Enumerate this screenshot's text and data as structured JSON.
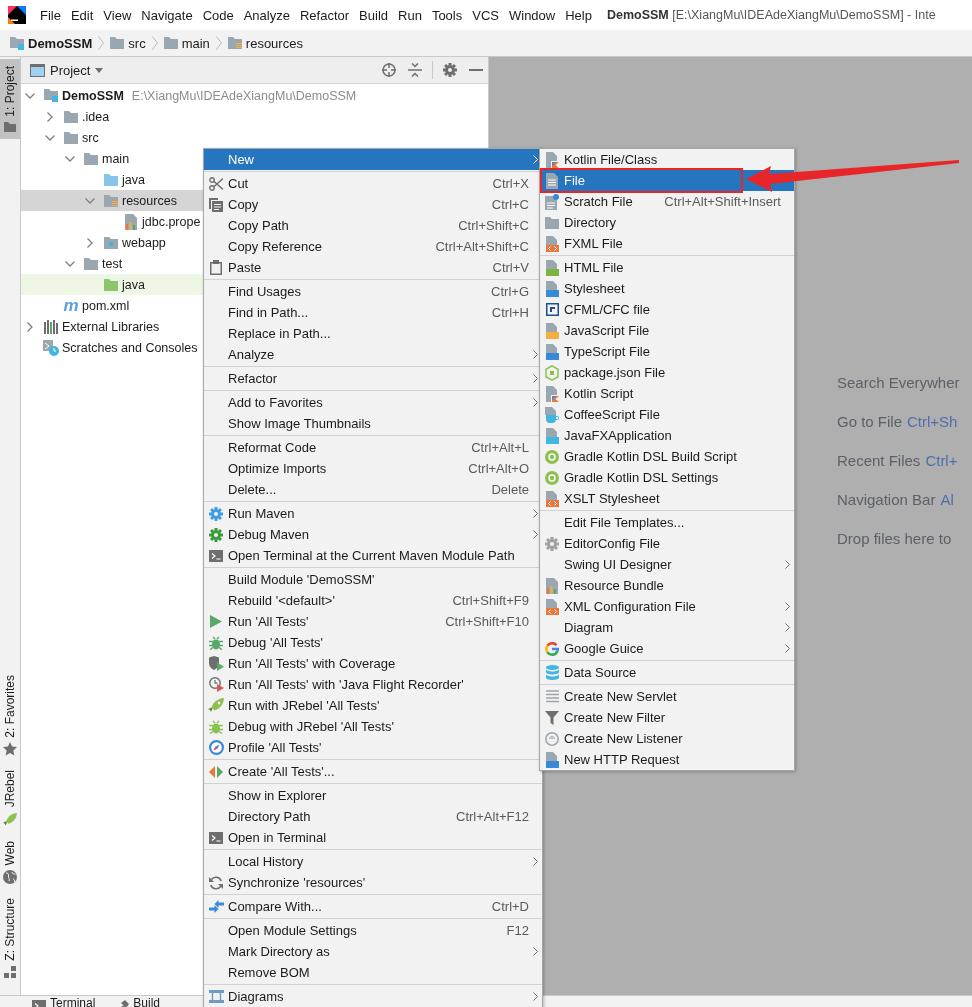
{
  "menubar": {
    "items": [
      {
        "label": "File"
      },
      {
        "label": "Edit"
      },
      {
        "label": "View"
      },
      {
        "label": "Navigate"
      },
      {
        "label": "Code"
      },
      {
        "label": "Analyze"
      },
      {
        "label": "Refactor"
      },
      {
        "label": "Build"
      },
      {
        "label": "Run"
      },
      {
        "label": "Tools"
      },
      {
        "label": "VCS"
      },
      {
        "label": "Window"
      },
      {
        "label": "Help"
      }
    ],
    "title": "**DemoSSM** [E:\\XiangMu\\IDEAdeXiangMu\\DemoSSM] - Inte"
  },
  "breadcrumb": [
    {
      "label": "DemoSSM",
      "kind": "module"
    },
    {
      "label": "src",
      "kind": "folder"
    },
    {
      "label": "main",
      "kind": "folder"
    },
    {
      "label": "resources",
      "kind": "resources"
    }
  ],
  "tool_strip": {
    "top": [
      {
        "label": "1: Project",
        "kind": "project",
        "selected": true
      }
    ],
    "bottom": [
      {
        "label": "2: Favorites",
        "kind": "favorites",
        "selected": false
      },
      {
        "label": "JRebel",
        "kind": "jrebel",
        "selected": false
      },
      {
        "label": "Web",
        "kind": "web",
        "selected": false
      },
      {
        "label": "Z: Structure",
        "kind": "structure",
        "selected": false
      }
    ]
  },
  "project_panel": {
    "title": "Project",
    "tree": [
      {
        "label": "DemoSSM",
        "path": "E:\\XiangMu\\IDEAdeXiangMu\\DemoSSM",
        "kind": "module",
        "expanded": true,
        "selected": false,
        "children": [
          {
            "label": ".idea",
            "kind": "folder",
            "expanded": false,
            "selected": false
          },
          {
            "label": "src",
            "kind": "folder",
            "expanded": true,
            "selected": false,
            "children": [
              {
                "label": "main",
                "kind": "folder",
                "expanded": true,
                "selected": false,
                "children": [
                  {
                    "label": "java",
                    "kind": "source",
                    "selected": false
                  },
                  {
                    "label": "resources",
                    "kind": "resources",
                    "expanded": true,
                    "selected": true,
                    "children": [
                      {
                        "label": "jdbc.prope",
                        "kind": "properties",
                        "selected": false
                      }
                    ]
                  },
                  {
                    "label": "webapp",
                    "kind": "web",
                    "expanded": false,
                    "selected": false
                  }
                ]
              },
              {
                "label": "test",
                "kind": "folder",
                "expanded": true,
                "selected": false,
                "children": [
                  {
                    "label": "java",
                    "kind": "test",
                    "color": "#eef7e6",
                    "selected": false
                  }
                ]
              }
            ]
          },
          {
            "label": "pom.xml",
            "kind": "maven",
            "glyph": "m",
            "selected": false
          }
        ]
      },
      {
        "label": "External Libraries",
        "kind": "libraries",
        "expanded": false,
        "selected": false
      },
      {
        "label": "Scratches and Consoles",
        "kind": "scratches",
        "selected": false
      }
    ]
  },
  "context_menu": {
    "groups": [
      [
        {
          "label": "New",
          "kind": "plain",
          "submenu": true,
          "selected": true
        }
      ],
      [
        {
          "label": "Cut",
          "shortcut": "Ctrl+X",
          "kind": "cut",
          "submenu": false,
          "selected": false
        },
        {
          "label": "Copy",
          "shortcut": "Ctrl+C",
          "kind": "copy",
          "submenu": false,
          "selected": false
        },
        {
          "label": "Copy Path",
          "shortcut": "Ctrl+Shift+C",
          "kind": "plain",
          "submenu": false,
          "selected": false
        },
        {
          "label": "Copy Reference",
          "shortcut": "Ctrl+Alt+Shift+C",
          "kind": "plain",
          "submenu": false,
          "selected": false
        },
        {
          "label": "Paste",
          "shortcut": "Ctrl+V",
          "kind": "paste",
          "submenu": false,
          "selected": false
        }
      ],
      [
        {
          "label": "Find Usages",
          "shortcut": "Ctrl+G",
          "kind": "plain",
          "submenu": false,
          "selected": false
        },
        {
          "label": "Find in Path...",
          "shortcut": "Ctrl+H",
          "kind": "plain",
          "submenu": false,
          "selected": false
        },
        {
          "label": "Replace in Path...",
          "kind": "plain",
          "submenu": false,
          "selected": false
        },
        {
          "label": "Analyze",
          "kind": "plain",
          "submenu": true,
          "selected": false
        }
      ],
      [
        {
          "label": "Refactor",
          "kind": "plain",
          "submenu": true,
          "selected": false
        }
      ],
      [
        {
          "label": "Add to Favorites",
          "kind": "plain",
          "submenu": true,
          "selected": false
        },
        {
          "label": "Show Image Thumbnails",
          "kind": "plain",
          "submenu": false,
          "selected": false
        }
      ],
      [
        {
          "label": "Reformat Code",
          "shortcut": "Ctrl+Alt+L",
          "kind": "plain",
          "submenu": false,
          "selected": false
        },
        {
          "label": "Optimize Imports",
          "shortcut": "Ctrl+Alt+O",
          "kind": "plain",
          "submenu": false,
          "selected": false
        },
        {
          "label": "Delete...",
          "shortcut": "Delete",
          "kind": "plain",
          "submenu": false,
          "selected": false
        }
      ],
      [
        {
          "label": "Run Maven",
          "kind": "mavenrun",
          "submenu": true,
          "selected": false
        },
        {
          "label": "Debug Maven",
          "kind": "mavendebug",
          "submenu": true,
          "selected": false
        },
        {
          "label": "Open Terminal at the Current Maven Module Path",
          "kind": "terminal",
          "submenu": false,
          "selected": false
        }
      ],
      [
        {
          "label": "Build Module 'DemoSSM'",
          "kind": "plain",
          "submenu": false,
          "selected": false
        },
        {
          "label": "Rebuild '<default>'",
          "shortcut": "Ctrl+Shift+F9",
          "kind": "plain",
          "submenu": false,
          "selected": false
        },
        {
          "label": "Run 'All Tests'",
          "shortcut": "Ctrl+Shift+F10",
          "kind": "run",
          "submenu": false,
          "selected": false
        },
        {
          "label": "Debug 'All Tests'",
          "kind": "debug",
          "submenu": false,
          "selected": false
        },
        {
          "label": "Run 'All Tests' with Coverage",
          "kind": "coverage",
          "submenu": false,
          "selected": false
        },
        {
          "label": "Run 'All Tests' with 'Java Flight Recorder'",
          "kind": "recorder",
          "submenu": false,
          "selected": false
        },
        {
          "label": "Run with JRebel 'All Tests'",
          "kind": "jrebel",
          "submenu": false,
          "selected": false
        },
        {
          "label": "Debug with JRebel 'All Tests'",
          "kind": "jrebeldebug",
          "submenu": false,
          "selected": false
        },
        {
          "label": "Profile 'All Tests'",
          "kind": "profile",
          "submenu": false,
          "selected": false
        }
      ],
      [
        {
          "label": "Create 'All Tests'...",
          "kind": "create",
          "submenu": false,
          "selected": false
        }
      ],
      [
        {
          "label": "Show in Explorer",
          "kind": "plain",
          "submenu": false,
          "selected": false
        },
        {
          "label": "Directory Path",
          "shortcut": "Ctrl+Alt+F12",
          "kind": "plain",
          "submenu": false,
          "selected": false
        },
        {
          "label": "Open in Terminal",
          "kind": "terminal",
          "submenu": false,
          "selected": false
        }
      ],
      [
        {
          "label": "Local History",
          "kind": "plain",
          "submenu": true,
          "selected": false
        },
        {
          "label": "Synchronize 'resources'",
          "kind": "sync",
          "submenu": false,
          "selected": false
        }
      ],
      [
        {
          "label": "Compare With...",
          "shortcut": "Ctrl+D",
          "kind": "compare",
          "submenu": false,
          "selected": false
        }
      ],
      [
        {
          "label": "Open Module Settings",
          "shortcut": "F12",
          "kind": "plain",
          "submenu": false,
          "selected": false
        },
        {
          "label": "Mark Directory as",
          "kind": "plain",
          "submenu": true,
          "selected": false
        },
        {
          "label": "Remove BOM",
          "kind": "plain",
          "submenu": false,
          "selected": false
        }
      ],
      [
        {
          "label": "Diagrams",
          "kind": "diagrams",
          "submenu": true,
          "selected": false
        }
      ]
    ]
  },
  "submenu": {
    "groups": [
      [
        {
          "label": "Kotlin File/Class",
          "kind": "kotlin",
          "submenu": false,
          "selected": false
        },
        {
          "label": "File",
          "kind": "file",
          "submenu": false,
          "selected": true
        },
        {
          "label": "Scratch File",
          "shortcut": "Ctrl+Alt+Shift+Insert",
          "kind": "scratch",
          "submenu": false,
          "selected": false
        },
        {
          "label": "Directory",
          "kind": "directory",
          "submenu": false,
          "selected": false
        },
        {
          "label": "FXML File",
          "kind": "fxml",
          "submenu": false,
          "selected": false
        }
      ],
      [
        {
          "label": "HTML File",
          "kind": "html",
          "submenu": false,
          "selected": false
        },
        {
          "label": "Stylesheet",
          "kind": "css",
          "submenu": false,
          "selected": false
        },
        {
          "label": "CFML/CFC file",
          "kind": "cfml",
          "submenu": false,
          "selected": false
        },
        {
          "label": "JavaScript File",
          "kind": "js",
          "submenu": false,
          "selected": false
        },
        {
          "label": "TypeScript File",
          "kind": "ts",
          "submenu": false,
          "selected": false
        },
        {
          "label": "package.json File",
          "kind": "packagejson",
          "submenu": false,
          "selected": false
        },
        {
          "label": "Kotlin Script",
          "kind": "kotlin",
          "submenu": false,
          "selected": false
        },
        {
          "label": "CoffeeScript File",
          "kind": "coffee",
          "submenu": false,
          "selected": false
        },
        {
          "label": "JavaFXApplication",
          "kind": "javafx",
          "submenu": false,
          "selected": false
        },
        {
          "label": "Gradle Kotlin DSL Build Script",
          "kind": "gradle",
          "submenu": false,
          "selected": false
        },
        {
          "label": "Gradle Kotlin DSL Settings",
          "kind": "gradle",
          "submenu": false,
          "selected": false
        },
        {
          "label": "XSLT Stylesheet",
          "kind": "xslt",
          "submenu": false,
          "selected": false
        }
      ],
      [
        {
          "label": "Edit File Templates...",
          "kind": "plain",
          "submenu": false,
          "selected": false
        },
        {
          "label": "EditorConfig File",
          "kind": "editorconfig",
          "submenu": false,
          "selected": false
        },
        {
          "label": "Swing UI Designer",
          "kind": "plain",
          "submenu": true,
          "selected": false
        },
        {
          "label": "Resource Bundle",
          "kind": "bundle",
          "submenu": false,
          "selected": false
        },
        {
          "label": "XML Configuration File",
          "kind": "xml",
          "submenu": true,
          "selected": false
        },
        {
          "label": "Diagram",
          "kind": "plain",
          "submenu": true,
          "selected": false
        },
        {
          "label": "Google Guice",
          "kind": "google",
          "submenu": true,
          "selected": false
        }
      ],
      [
        {
          "label": "Data Source",
          "kind": "database",
          "submenu": false,
          "selected": false
        }
      ],
      [
        {
          "label": "Create New Servlet",
          "kind": "servlet",
          "submenu": false,
          "selected": false
        },
        {
          "label": "Create New Filter",
          "kind": "filter",
          "submenu": false,
          "selected": false
        },
        {
          "label": "Create New Listener",
          "kind": "listener",
          "submenu": false,
          "selected": false
        },
        {
          "label": "New HTTP Request",
          "kind": "http",
          "submenu": false,
          "selected": false
        }
      ]
    ]
  },
  "welcome": [
    {
      "label": "Search Everywher"
    },
    {
      "label": "Go to File",
      "shortcut": "Ctrl+Sh"
    },
    {
      "label": "Recent Files",
      "shortcut": "Ctrl+"
    },
    {
      "label": "Navigation Bar",
      "shortcut": "Al"
    },
    {
      "label": "Drop files here to"
    }
  ],
  "bottom_bar": [
    {
      "label": "Terminal",
      "kind": "terminal"
    },
    {
      "label": "Build",
      "kind": "build"
    }
  ]
}
